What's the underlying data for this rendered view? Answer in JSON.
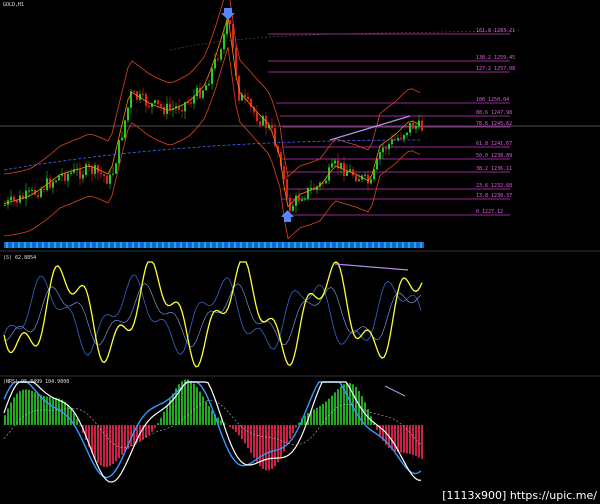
{
  "symbol_label": "GOLD,H1",
  "indicator2_label": "(S) 62.8854",
  "indicator3_label": "(NRS) 95.8499 104.9000",
  "watermark": "[1113x900] https://upic.me/",
  "fib_labels": [
    "161.8 1283.21",
    "138.2 1259.45",
    "127.2 1257.08",
    "100 1250.04",
    "88.6 1247.98",
    "78.6 1245.62",
    "61.8 1241.67",
    "50.0 1238.89",
    "38.2 1236.11",
    "23.6 1232.68",
    "13.8 1230.37",
    "0 1227.12"
  ],
  "colors": {
    "background": "#000000",
    "bull_candle": "#22cc22",
    "bear_candle": "#dd2222",
    "fib_line": "#cc33cc",
    "oscillator": "#ffff33",
    "signal": "#3399ff",
    "histogram_up": "#22aa22",
    "histogram_down": "#cc2244",
    "arrow": "#5588ff"
  },
  "icons": [
    "arrow-down-icon",
    "arrow-up-icon"
  ]
}
